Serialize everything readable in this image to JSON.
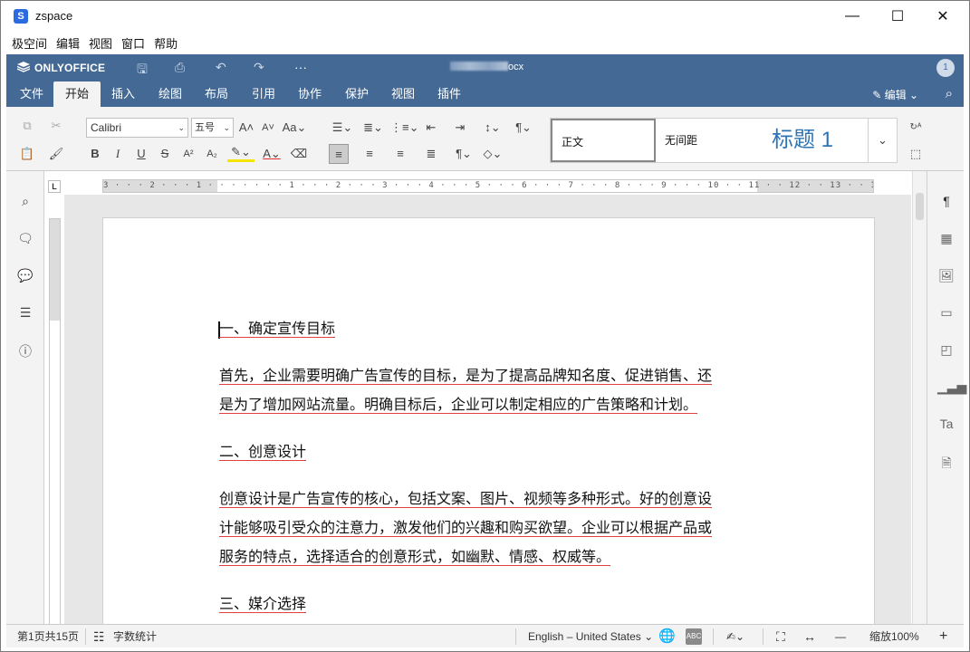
{
  "window": {
    "title": "zspace",
    "minimize": "—",
    "maximize": "☐",
    "close": "✕"
  },
  "menubar": [
    "极空间",
    "编辑",
    "视图",
    "窗口",
    "帮助"
  ],
  "header": {
    "brand": "ONLYOFFICE",
    "doc_ext": "ocx",
    "user_initial": "1"
  },
  "tabs": [
    "文件",
    "开始",
    "插入",
    "绘图",
    "布局",
    "引用",
    "协作",
    "保护",
    "视图",
    "插件"
  ],
  "active_tab": "开始",
  "edit_mode": "编辑",
  "toolbar": {
    "font_name": "Calibri",
    "font_size": "五号",
    "bold": "B",
    "italic": "I",
    "underline": "U",
    "strike": "S",
    "superscript": "A²",
    "subscript": "A₂"
  },
  "styles": {
    "normal": "正文",
    "no_spacing": "无间距",
    "heading1": "标题 1"
  },
  "ruler": {
    "h_ticks": "3 · · · 2 · · · 1 · · · · · · · 1 · · · 2 · · · 3 · · · 4 · · · 5 · · · 6 · · · 7 · · · 8 · · · 9 · · · 10 · · 11 · · 12 · · 13 · · 14 · · 15 · · 16 · · 17 · ·",
    "corner": "L"
  },
  "document": {
    "p1": "一、确定宣传目标",
    "p2a": "首先，企业需要明确广告宣传的目标，是为了提高品牌知名度、促进销售、还",
    "p2b": "是为了增加网站流量。明确目标后，企业可以制定相应的广告策略和计划。",
    "p3": "二、创意设计",
    "p4a": "创意设计是广告宣传的核心，包括文案、图片、视频等多种形式。好的创意设",
    "p4b": "计能够吸引受众的注意力，激发他们的兴趣和购买欲望。企业可以根据产品或",
    "p4c": "服务的特点，选择适合的创意形式，如幽默、情感、权威等。",
    "p5": "三、媒介选择"
  },
  "status": {
    "pages": "第1页共15页",
    "word_count": "字数统计",
    "language": "English – United States",
    "zoom": "缩放100%",
    "minus": "—",
    "plus": "+"
  }
}
